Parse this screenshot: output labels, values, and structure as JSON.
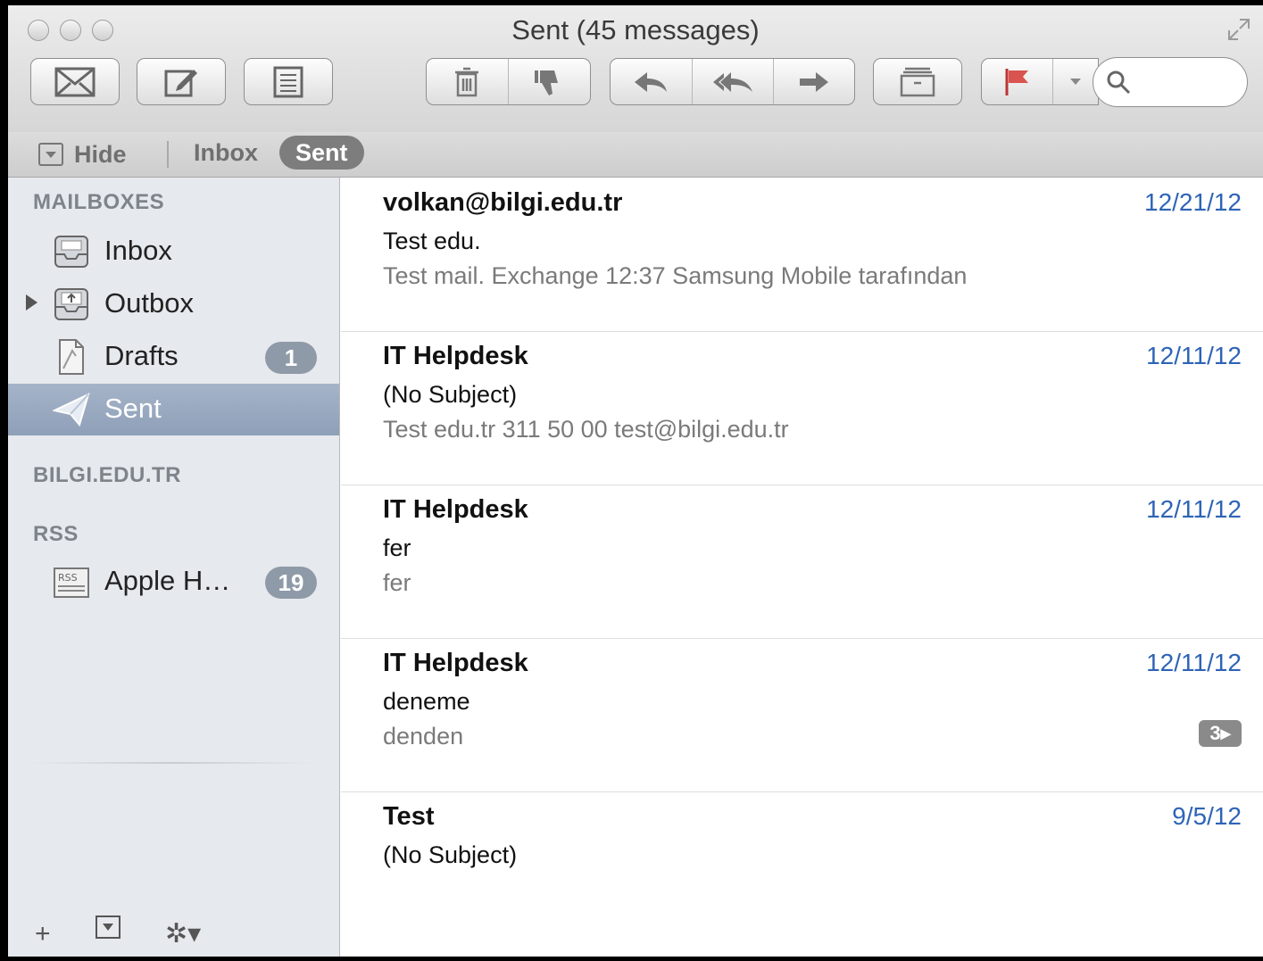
{
  "window": {
    "title": "Sent (45 messages)"
  },
  "toolbar": {
    "buttons": [
      "get-mail",
      "compose",
      "notes",
      "delete",
      "junk",
      "reply",
      "reply-all",
      "forward",
      "archive",
      "flag"
    ],
    "search": {
      "value": "",
      "placeholder": ""
    }
  },
  "favorites": {
    "hide_label": "Hide",
    "inbox_label": "Inbox",
    "sent_label": "Sent"
  },
  "sidebar": {
    "mailboxes_header": "MAILBOXES",
    "items": [
      {
        "label": "Inbox",
        "icon": "inbox-tray-icon"
      },
      {
        "label": "Outbox",
        "icon": "outbox-tray-icon"
      },
      {
        "label": "Drafts",
        "icon": "drafts-doc-icon",
        "badge": "1"
      },
      {
        "label": "Sent",
        "icon": "paper-plane-icon",
        "selected": true
      }
    ],
    "account_header": "BILGI.EDU.TR",
    "rss_header": "RSS",
    "rss_items": [
      {
        "label": "Apple H…",
        "icon": "rss-feed-icon",
        "badge": "19"
      }
    ],
    "bottom": {
      "add": "+",
      "gear": "✲▾"
    }
  },
  "messages": [
    {
      "from": "volkan@bilgi.edu.tr",
      "date": "12/21/12",
      "subject": "Test edu.",
      "preview": "Test mail. Exchange 12:37 Samsung Mobile tarafından"
    },
    {
      "from": "IT Helpdesk",
      "date": "12/11/12",
      "subject": "(No Subject)",
      "preview": "Test edu.tr 311 50 00 test@bilgi.edu.tr"
    },
    {
      "from": "IT Helpdesk",
      "date": "12/11/12",
      "subject": "fer",
      "preview": "fer"
    },
    {
      "from": "IT Helpdesk",
      "date": "12/11/12",
      "subject": "deneme",
      "preview": "denden",
      "thread_count": "3▸"
    },
    {
      "from": "Test",
      "date": "9/5/12",
      "subject": "(No Subject)",
      "preview": ""
    }
  ],
  "colors": {
    "accent": "#2e64b6",
    "selection": "#93a3bb"
  }
}
